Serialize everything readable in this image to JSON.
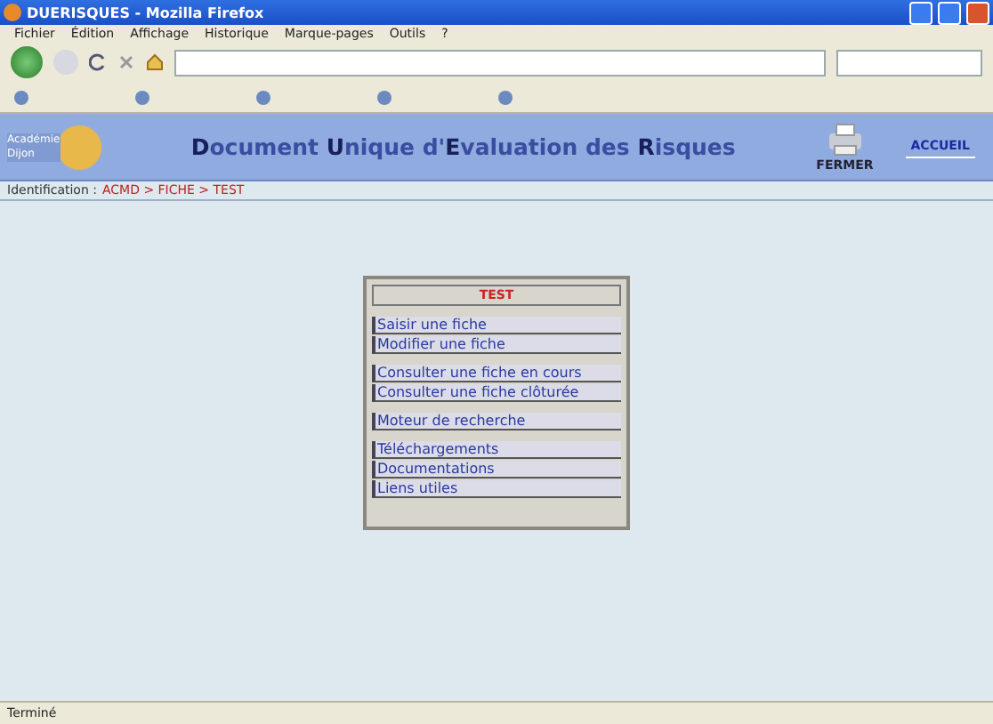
{
  "window": {
    "title": "DUERISQUES - Mozilla Firefox"
  },
  "menu_bar": [
    "Fichier",
    "Édition",
    "Affichage",
    "Historique",
    "Marque-pages",
    "Outils",
    "?"
  ],
  "header": {
    "logo_text": "Académie Dijon",
    "title": "**D**ocument **U**nique d'**E**valuation des **R**isques",
    "close_label": "FERMER",
    "home_link": "ACCUEIL"
  },
  "breadcrumb": {
    "label": "Identification :",
    "path": "ACMD > FICHE > TEST"
  },
  "menu_box": {
    "title": "TEST",
    "groups": [
      [
        "Saisir une fiche",
        "Modifier une fiche"
      ],
      [
        "Consulter une fiche en cours",
        "Consulter une fiche clôturée"
      ],
      [
        "Moteur de recherche"
      ],
      [
        "Téléchargements",
        "Documentations",
        "Liens utiles"
      ]
    ]
  },
  "status_bar": {
    "text": "Terminé"
  }
}
